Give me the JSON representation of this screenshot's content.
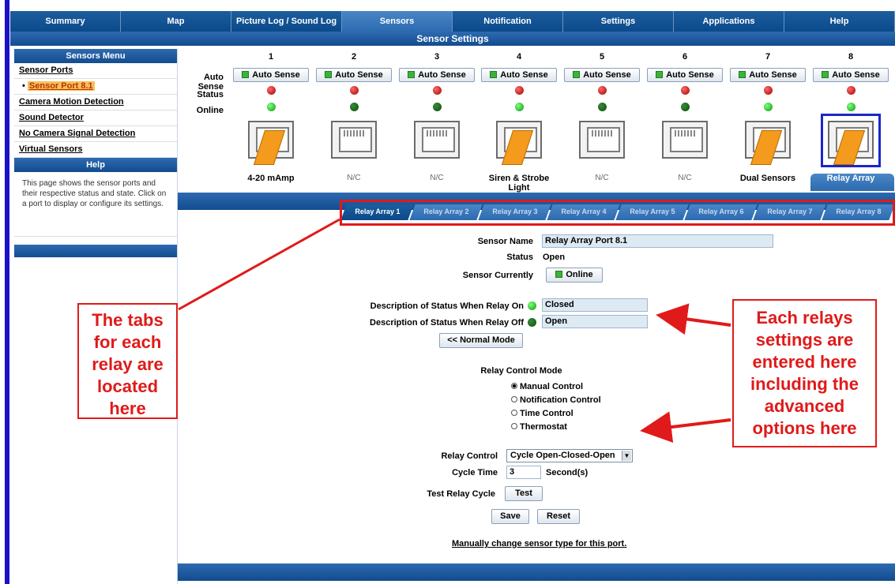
{
  "nav": {
    "tabs": [
      "Summary",
      "Map",
      "Picture Log / Sound Log",
      "Sensors",
      "Notification",
      "Settings",
      "Applications",
      "Help"
    ],
    "active": "Sensors"
  },
  "page_title": "Sensor Settings",
  "sidebar": {
    "menu_title": "Sensors Menu",
    "items": [
      "Sensor Ports",
      "Sensor Port 8.1",
      "Camera Motion Detection",
      "Sound Detector",
      "No Camera Signal Detection",
      "Virtual Sensors"
    ],
    "help_title": "Help",
    "help_text": "This page shows the sensor ports and their respective status and state. Click on a port to display or configure its settings."
  },
  "ports": {
    "row_labels": {
      "auto_sense": "Auto Sense",
      "status": "Status",
      "online": "Online"
    },
    "auto_sense_label": "Auto Sense",
    "items": [
      {
        "num": "1",
        "status": "red",
        "online": "green",
        "label": "4-20 mAmp",
        "connected": true
      },
      {
        "num": "2",
        "status": "red",
        "online": "dkgreen",
        "label": "N/C",
        "connected": false
      },
      {
        "num": "3",
        "status": "red",
        "online": "dkgreen",
        "label": "N/C",
        "connected": false
      },
      {
        "num": "4",
        "status": "red",
        "online": "green",
        "label": "Siren & Strobe Light",
        "connected": true
      },
      {
        "num": "5",
        "status": "red",
        "online": "dkgreen",
        "label": "N/C",
        "connected": false
      },
      {
        "num": "6",
        "status": "red",
        "online": "dkgreen",
        "label": "N/C",
        "connected": false
      },
      {
        "num": "7",
        "status": "red",
        "online": "green",
        "label": "Dual Sensors",
        "connected": true
      },
      {
        "num": "8",
        "status": "red",
        "online": "green",
        "label": "Relay Array",
        "connected": true,
        "selected": true
      }
    ]
  },
  "relay_tabs": [
    "Relay Array 1",
    "Relay Array 2",
    "Relay Array 3",
    "Relay Array 4",
    "Relay Array 5",
    "Relay Array 6",
    "Relay Array 7",
    "Relay Array 8"
  ],
  "form": {
    "sensor_name_label": "Sensor Name",
    "sensor_name": "Relay Array Port 8.1",
    "status_label": "Status",
    "status": "Open",
    "currently_label": "Sensor Currently",
    "currently": "Online",
    "relay_on_label": "Description of Status When Relay On",
    "relay_on": "Closed",
    "relay_off_label": "Description of Status When Relay Off",
    "relay_off": "Open",
    "normal_mode": "<< Normal Mode",
    "mode_title": "Relay Control Mode",
    "modes": [
      "Manual Control",
      "Notification Control",
      "Time Control",
      "Thermostat"
    ],
    "relay_control_label": "Relay Control",
    "relay_control": "Cycle Open-Closed-Open",
    "cycle_time_label": "Cycle Time",
    "cycle_time": "3",
    "cycle_unit": "Second(s)",
    "test_label": "Test Relay Cycle",
    "test_button": "Test",
    "save": "Save",
    "reset": "Reset",
    "manual_link": "Manually change sensor type for this port."
  },
  "callouts": {
    "left": [
      "The tabs",
      "for each",
      "relay are",
      "located",
      "here"
    ],
    "right": [
      "Each relays",
      "settings are",
      "entered here",
      "including the",
      "advanced",
      "options here"
    ]
  },
  "colors": {
    "nav": "#0b4a8a",
    "accent": "#2c6bb0",
    "callout": "#e01a1a",
    "port_plug": "#f49a1c"
  }
}
